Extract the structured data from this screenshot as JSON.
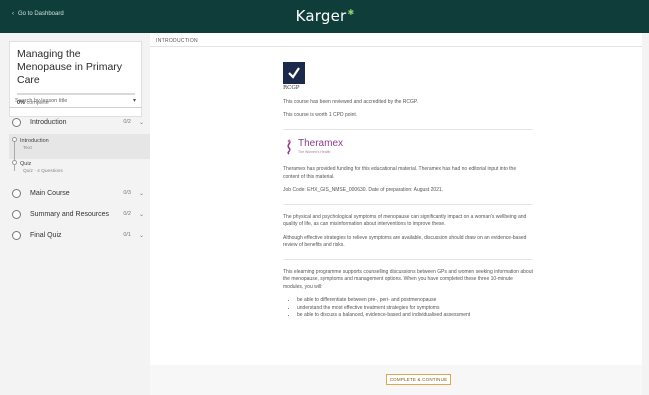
{
  "topbar": {
    "back_label": "Go to Dashboard",
    "brand": "Karger",
    "brand_color": "#0f3d3a"
  },
  "sidebar": {
    "course_title": "Managing the Menopause in Primary Care",
    "progress_percent": 0,
    "progress_bold": "0%",
    "progress_suffix": " complete",
    "search_placeholder": "Search by lesson title",
    "lessons": [
      {
        "title": "Introduction",
        "count": "0/2"
      },
      {
        "title": "Main Course",
        "count": "0/3"
      },
      {
        "title": "Summary and Resources",
        "count": "0/2"
      },
      {
        "title": "Final Quiz",
        "count": "0/1"
      }
    ],
    "intro_items": [
      {
        "title": "Introduction",
        "meta": "Text"
      },
      {
        "title": "Quiz",
        "meta": "Quiz · 4 Questions"
      }
    ]
  },
  "content": {
    "section_label": "INTRODUCTION",
    "rcgp_label": "RCGP",
    "p1": "This course has been reviewed and accredited by the RCGP.",
    "p2": "This course is worth 1 CPD point.",
    "theramex_name": "Theramex",
    "theramex_tag": "The Women's Health",
    "p3": "Theramex has provided funding for this educational material. Theramex has had no editorial input into the content of this material.",
    "p4": "Job Code: EHX_GIS_NMSE_000630. Date of preparation: August 2021.",
    "p5": "The physical and psychological symptoms of menopause can significantly impact on a woman's wellbeing and quality of life, as can misinformation about interventions to improve these.",
    "p6": "Although effective strategies to relieve symptoms are available, discussion should draw on an evidence-based review of benefits and risks.",
    "p7": "This elearning programme supports counselling discussions between GPs and women seeking information about the menopause, symptoms and management options. When you have completed these three 10-minute modules, you will:",
    "bullets": [
      "be able to differentiate between pre-, peri- and postmenopause",
      "understand the most effective treatment strategies for symptoms",
      "be able to discuss a balanced, evidence-based and individualised assessment"
    ]
  },
  "footer": {
    "complete_label": "COMPLETE & CONTINUE",
    "accent": "#e0a64a"
  }
}
